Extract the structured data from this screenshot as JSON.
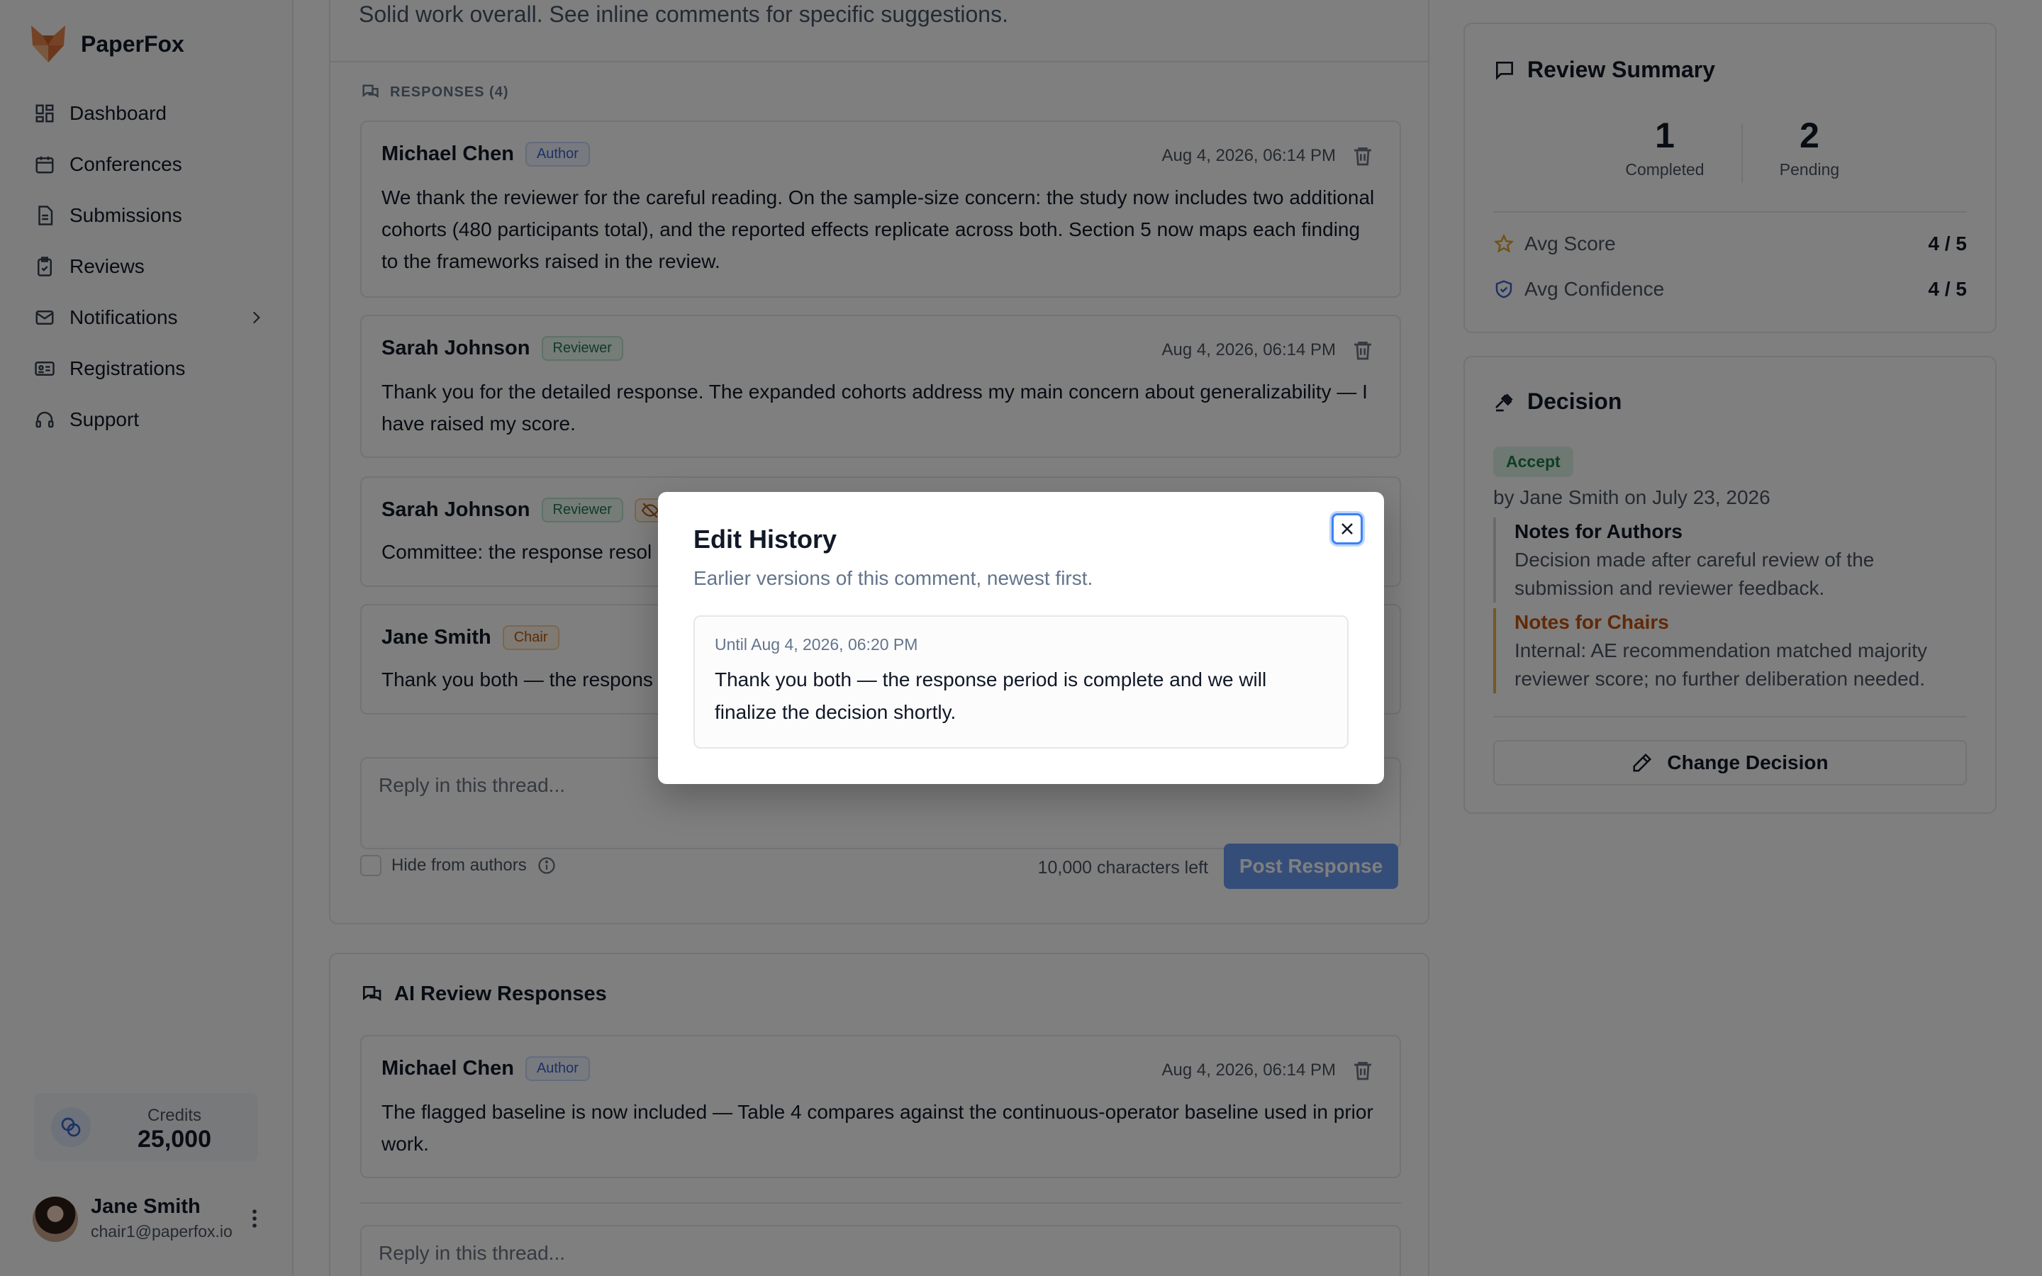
{
  "app": {
    "name": "PaperFox"
  },
  "sidebar": {
    "items": [
      {
        "label": "Dashboard",
        "icon": "dashboard-icon"
      },
      {
        "label": "Conferences",
        "icon": "calendar-icon"
      },
      {
        "label": "Submissions",
        "icon": "file-icon"
      },
      {
        "label": "Reviews",
        "icon": "clipboard-icon"
      },
      {
        "label": "Notifications",
        "icon": "mail-icon"
      },
      {
        "label": "Registrations",
        "icon": "id-card-icon"
      },
      {
        "label": "Support",
        "icon": "headset-icon"
      }
    ],
    "credits_label": "Credits",
    "credits_value": "25,000",
    "user_name": "Jane Smith",
    "user_email": "chair1@paperfox.io"
  },
  "review": {
    "summary_text": "Solid work overall. See inline comments for specific suggestions.",
    "responses_header": "RESPONSES (4)",
    "comments": [
      {
        "name": "Michael Chen",
        "role": "Author",
        "time": "Aug 4, 2026, 06:14 PM",
        "body": "We thank the reviewer for the careful reading. On the sample-size concern: the study now includes two additional cohorts (480 participants total), and the reported effects replicate across both. Section 5 now maps each finding to the frameworks raised in the review."
      },
      {
        "name": "Sarah Johnson",
        "role": "Reviewer",
        "time": "Aug 4, 2026, 06:14 PM",
        "body": "Thank you for the detailed response. The expanded cohorts address my main concern about generalizability — I have raised my score."
      },
      {
        "name": "Sarah Johnson",
        "role": "Reviewer",
        "time": "",
        "body": "Committee: the response resol"
      },
      {
        "name": "Jane Smith",
        "role": "Chair",
        "time": "",
        "body": "Thank you both — the respons"
      }
    ],
    "reply_placeholder": "Reply in this thread...",
    "hide_label": "Hide from authors",
    "chars_left": "10,000 characters left",
    "post_button": "Post Response"
  },
  "ai_responses": {
    "title": "AI Review Responses",
    "comment": {
      "name": "Michael Chen",
      "role": "Author",
      "time": "Aug 4, 2026, 06:14 PM",
      "body": "The flagged baseline is now included — Table 4 compares against the continuous-operator baseline used in prior work."
    },
    "reply_placeholder": "Reply in this thread..."
  },
  "summary": {
    "title": "Review Summary",
    "completed": "1",
    "completed_label": "Completed",
    "pending": "2",
    "pending_label": "Pending",
    "avg_score_label": "Avg Score",
    "avg_score": "4 / 5",
    "avg_confidence_label": "Avg Confidence",
    "avg_confidence": "4 / 5"
  },
  "decision": {
    "title": "Decision",
    "status": "Accept",
    "by": "by Jane Smith on July 23, 2026",
    "authors_title": "Notes for Authors",
    "authors_text": "Decision made after careful review of the submission and reviewer feedback.",
    "chairs_title": "Notes for Chairs",
    "chairs_text": "Internal: AE recommendation matched majority reviewer score; no further deliberation needed.",
    "change_button": "Change Decision"
  },
  "modal": {
    "title": "Edit History",
    "subtitle": "Earlier versions of this comment, newest first.",
    "version_date": "Until Aug 4, 2026, 06:20 PM",
    "version_text": "Thank you both — the response period is complete and we will finalize the decision shortly."
  },
  "colors": {
    "author_badge": "#3b63c9",
    "reviewer_badge": "#1f7a4a",
    "chair_badge": "#b8560b",
    "primary": "#6b9cf2",
    "accept": "#1f7a4a"
  }
}
